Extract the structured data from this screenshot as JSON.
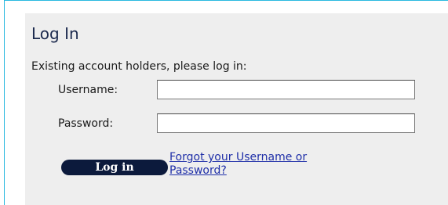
{
  "login": {
    "title": "Log In",
    "subtitle": "Existing account holders, please log in:",
    "username_label": "Username:",
    "username_value": "",
    "password_label": "Password:",
    "password_value": "",
    "login_button_label": "Log in",
    "forgot_link": "Forgot your Username or Password?"
  },
  "colors": {
    "frame_border": "#29b9e0",
    "panel_background": "#eeeeee",
    "title_text": "#1c2a4e",
    "button_background": "#0c1a3c",
    "link": "#1f2fa8"
  }
}
